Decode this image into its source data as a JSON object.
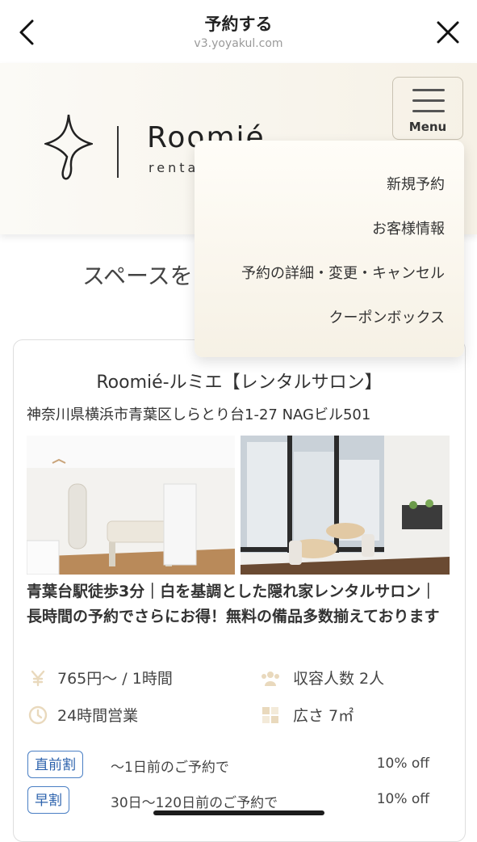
{
  "browser": {
    "title": "予約する",
    "url": "v3.yoyakul.com"
  },
  "site": {
    "brand_name": "Roomié",
    "brand_sub": "rental",
    "menu_label": "Menu",
    "dropdown": [
      "新規予約",
      "お客様情報",
      "予約の詳細・変更・キャンセル",
      "クーポンボックス"
    ],
    "section_heading": "スペースを"
  },
  "space": {
    "title": "Roomié-ルミエ【レンタルサロン】",
    "address": "神奈川県横浜市青葉区しらとり台1-27 NAGビル501",
    "description": "青葉台駅徒歩3分｜白を基調とした隠れ家レンタルサロン｜長時間の予約でさらにお得！無料の備品多数揃えております",
    "price": "765円〜 / 1時間",
    "capacity": "収容人数 2人",
    "hours": "24時間営業",
    "area": "広さ 7㎡",
    "discounts": [
      {
        "badge": "直前割",
        "text": "〜1日前のご予約で",
        "value": "10% off"
      },
      {
        "badge": "早割",
        "text": "30日〜120日前のご予約で",
        "value": "10% off"
      }
    ]
  },
  "icons": [
    "back-arrow-icon",
    "close-icon",
    "menu-icon",
    "yen-icon",
    "people-icon",
    "clock-icon",
    "area-icon"
  ]
}
